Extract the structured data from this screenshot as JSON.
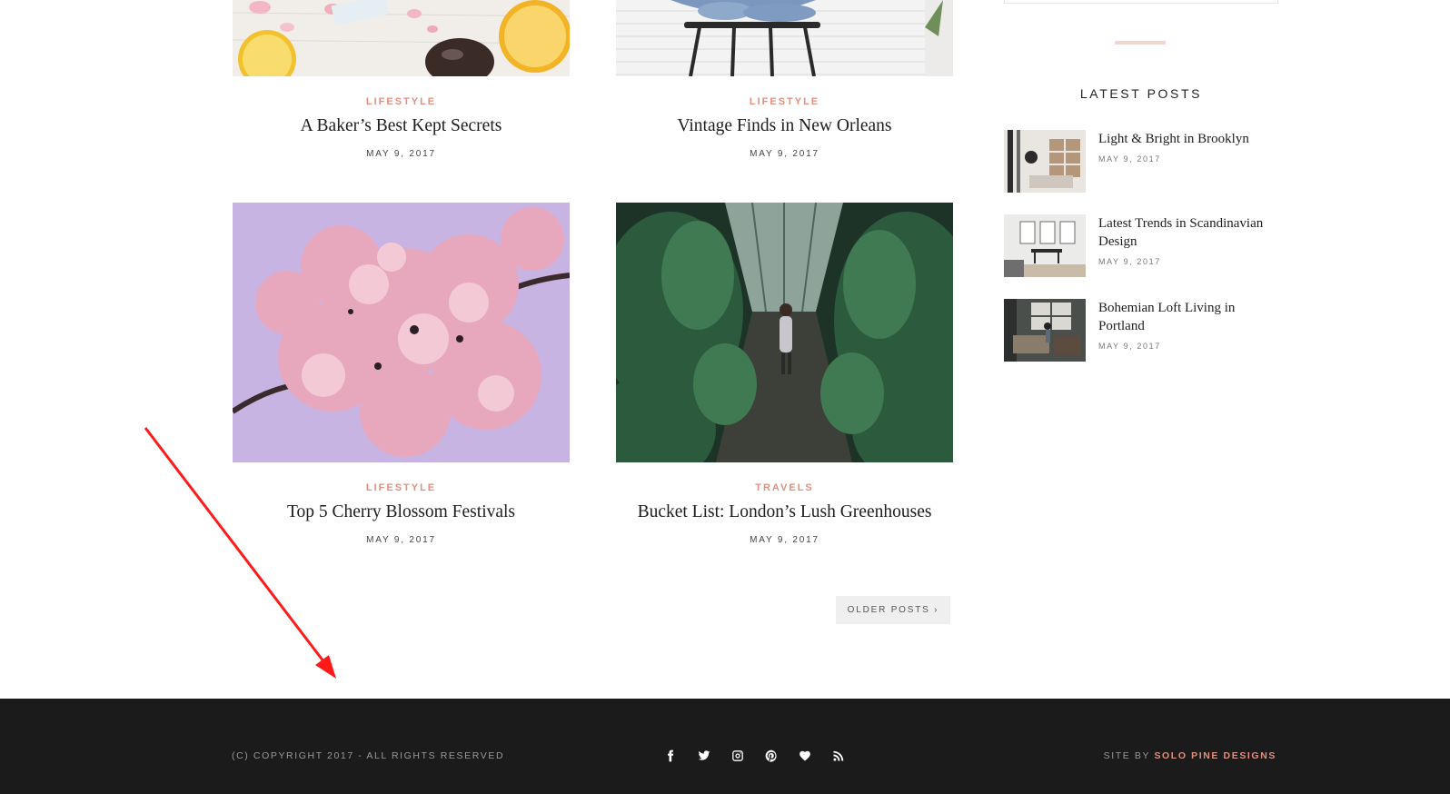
{
  "posts": [
    {
      "category": "LIFESTYLE",
      "title": "A Baker’s Best Kept Secrets",
      "date": "MAY 9, 2017"
    },
    {
      "category": "LIFESTYLE",
      "title": "Vintage Finds in New Orleans",
      "date": "MAY 9, 2017"
    },
    {
      "category": "LIFESTYLE",
      "title": "Top 5 Cherry Blossom Festivals",
      "date": "MAY 9, 2017"
    },
    {
      "category": "TRAVELS",
      "title": "Bucket List: London’s Lush Greenhouses",
      "date": "MAY 9, 2017"
    }
  ],
  "pagination": {
    "older_label": "OLDER POSTS ›"
  },
  "sidebar": {
    "heading": "LATEST POSTS",
    "items": [
      {
        "title": "Light & Bright in Brooklyn",
        "date": "MAY 9, 2017"
      },
      {
        "title": "Latest Trends in Scandinavian Design",
        "date": "MAY 9, 2017"
      },
      {
        "title": "Bohemian Loft Living in Portland",
        "date": "MAY 9, 2017"
      }
    ]
  },
  "footer": {
    "copyright": "(C) COPYRIGHT 2017 - ALL RIGHTS RESERVED",
    "credit_prefix": "SITE BY ",
    "credit_brand": "SOLO PINE DESIGNS",
    "social_icons": [
      "facebook-icon",
      "twitter-icon",
      "instagram-icon",
      "pinterest-icon",
      "bloglovin-heart-icon",
      "rss-icon"
    ]
  },
  "colors": {
    "accent": "#e0907e",
    "footer_bg": "#1b1b1b",
    "annotation_arrow": "#ff1a1a"
  }
}
